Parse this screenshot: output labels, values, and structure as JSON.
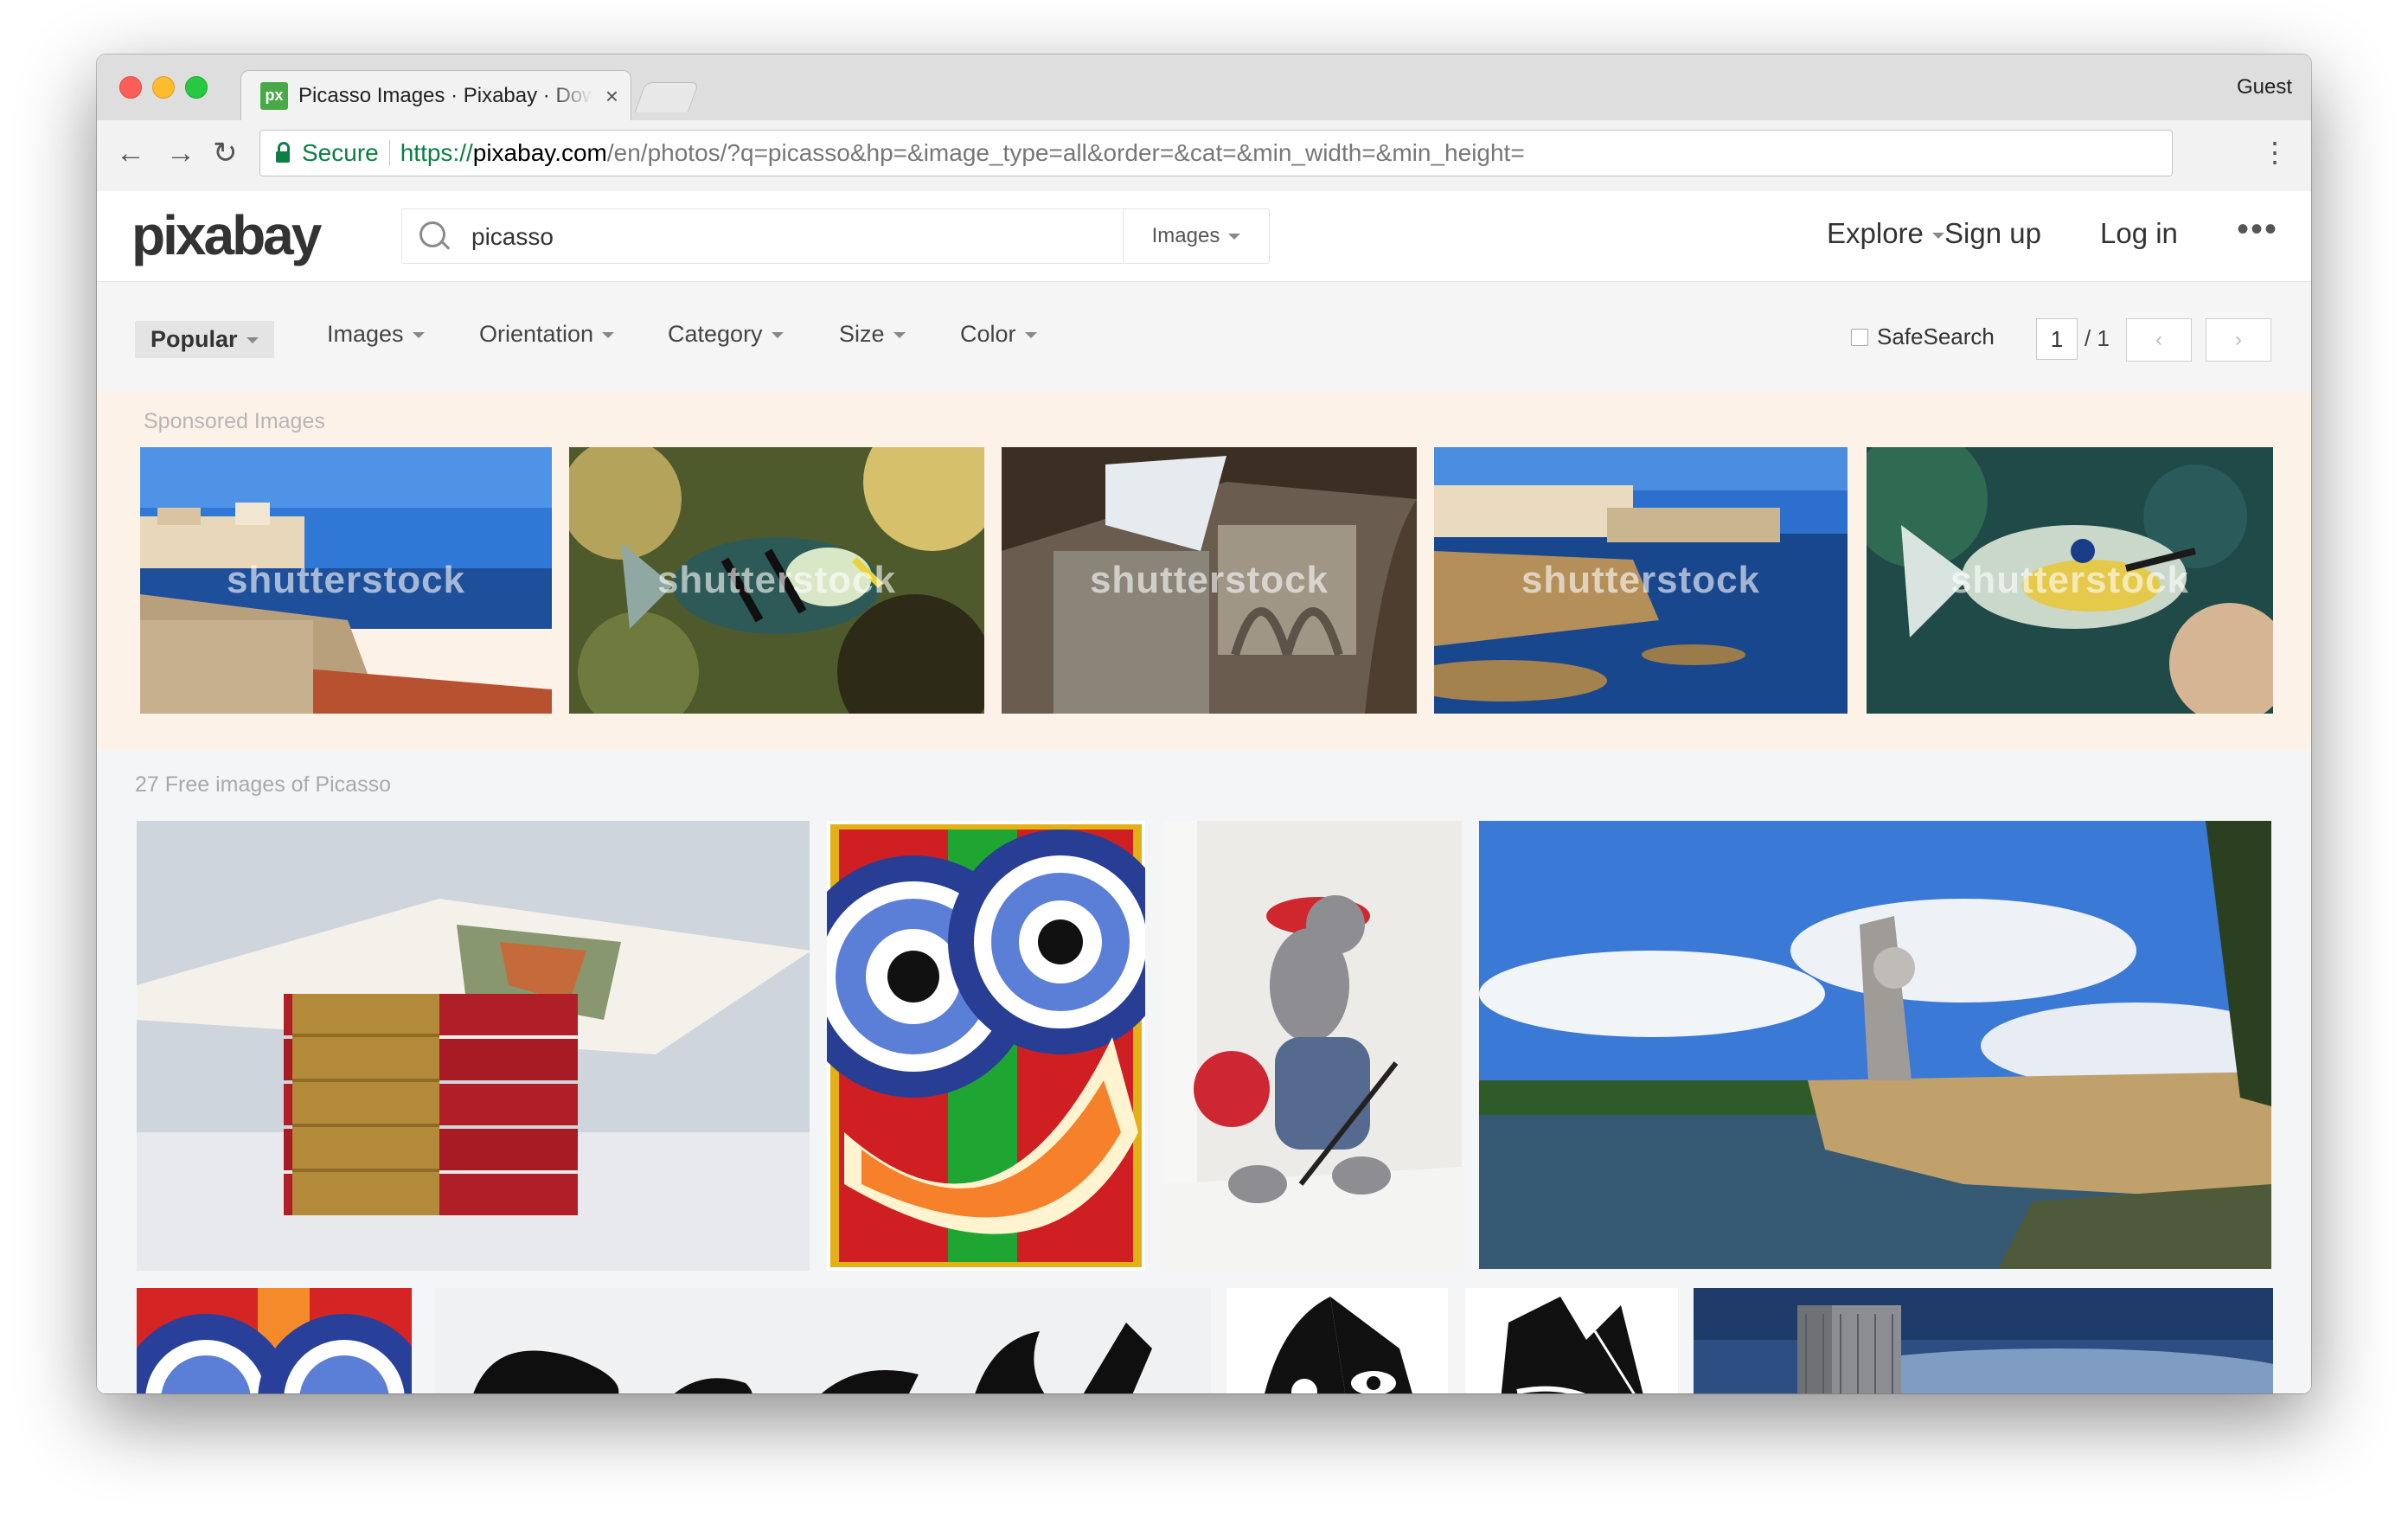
{
  "browser": {
    "tab_title": "Picasso Images · Pixabay · Download Free Pictures",
    "tab_close": "×",
    "user": "Guest",
    "secure_label": "Secure",
    "url_scheme": "https://",
    "url_host": "pixabay.com",
    "url_path": "/en/photos/?q=picasso&hp=&image_type=all&order=&cat=&min_width=&min_height=",
    "back": "←",
    "forward": "→",
    "reload": "↻",
    "menu": "⋮"
  },
  "site": {
    "logo": "pixabay",
    "search_value": "picasso",
    "search_scope": "Images",
    "nav": {
      "explore": "Explore",
      "signup": "Sign up",
      "login": "Log in",
      "more": "•••"
    }
  },
  "filters": {
    "popular": "Popular",
    "images": "Images",
    "orientation": "Orientation",
    "category": "Category",
    "size": "Size",
    "color": "Color",
    "safesearch": "SafeSearch",
    "page_current": "1",
    "page_total": "/ 1",
    "prev": "‹",
    "next": "›"
  },
  "sponsored": {
    "label": "Sponsored Images",
    "watermark": "shutterstock"
  },
  "results": {
    "label": "27 Free images of Picasso"
  }
}
